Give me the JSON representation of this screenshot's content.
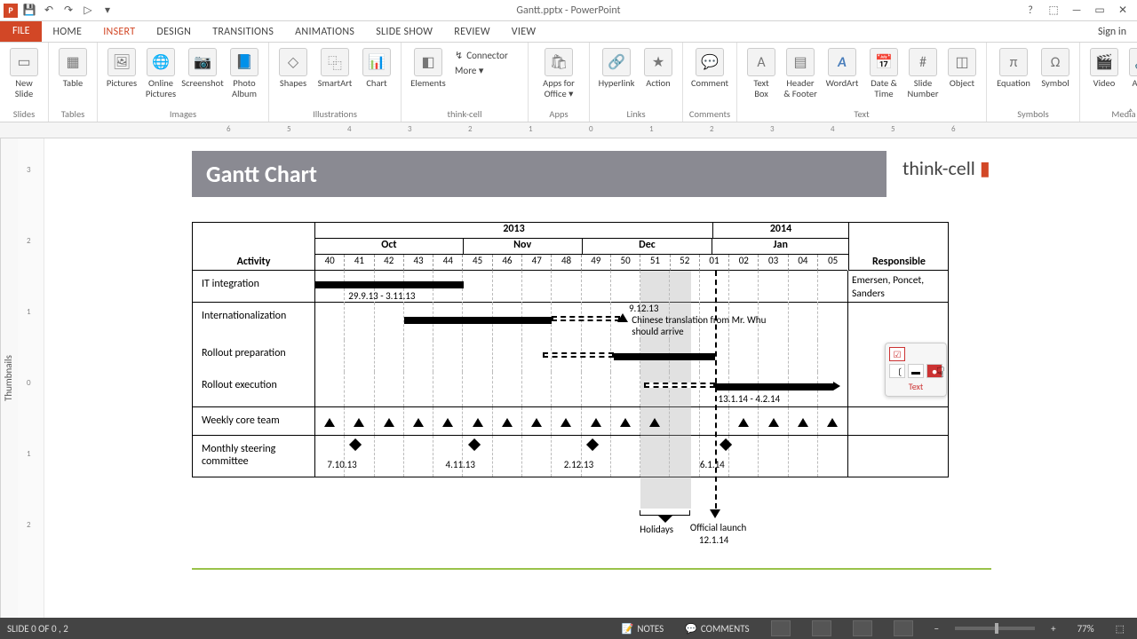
{
  "app": {
    "title": "Gantt.pptx - PowerPoint"
  },
  "qat": {
    "save": "💾",
    "undo": "↶",
    "redo": "↷",
    "start": "▷"
  },
  "win": {
    "help": "?",
    "ribopts": "⬚",
    "min": "—",
    "restore": "▭",
    "close": "✕"
  },
  "tabs": {
    "file": "FILE",
    "home": "HOME",
    "insert": "INSERT",
    "design": "DESIGN",
    "transitions": "TRANSITIONS",
    "animations": "ANIMATIONS",
    "slideshow": "SLIDE SHOW",
    "review": "REVIEW",
    "view": "VIEW",
    "signin": "Sign in"
  },
  "ribbon": {
    "newslide": "New\nSlide",
    "slides": "Slides",
    "table": "Table",
    "tables": "Tables",
    "pictures": "Pictures",
    "online_pictures": "Online\nPictures",
    "screenshot": "Screenshot",
    "photo_album": "Photo\nAlbum",
    "images": "Images",
    "shapes": "Shapes",
    "smartart": "SmartArt",
    "chart": "Chart",
    "elements": "Elements",
    "connector": "Connector",
    "more": "More ▾",
    "illustrations": "Illustrations",
    "thinkcell": "think-cell",
    "apps_office": "Apps for\nOffice ▾",
    "apps": "Apps",
    "hyperlink": "Hyperlink",
    "action": "Action",
    "links": "Links",
    "comment": "Comment",
    "comments_g": "Comments",
    "textbox": "Text\nBox",
    "headerfooter": "Header\n& Footer",
    "wordart": "WordArt",
    "datetime": "Date &\nTime",
    "slidenum": "Slide\nNumber",
    "object": "Object",
    "text_g": "Text",
    "equation": "Equation",
    "symbol": "Symbol",
    "symbols_g": "Symbols",
    "video": "Video",
    "audio": "Audio",
    "media_g": "Media"
  },
  "ruler_h": [
    "6",
    "5",
    "4",
    "3",
    "2",
    "1",
    "0",
    "1",
    "2",
    "3",
    "4",
    "5",
    "6"
  ],
  "ruler_v": [
    "3",
    "2",
    "1",
    "0",
    "1",
    "2"
  ],
  "thumbnails_label": "Thumbnails",
  "slide": {
    "title": "Gantt Chart",
    "logo_a": "think-cell",
    "logo_b": "▮"
  },
  "chart_data": {
    "type": "gantt",
    "columns": {
      "activity": "Activity",
      "responsible": "Responsible"
    },
    "years": [
      "2013",
      "2014"
    ],
    "months": [
      "Oct",
      "Nov",
      "Dec",
      "Jan"
    ],
    "weeks": [
      "40",
      "41",
      "42",
      "43",
      "44",
      "45",
      "46",
      "47",
      "48",
      "49",
      "50",
      "51",
      "52",
      "01",
      "02",
      "03",
      "04",
      "05"
    ],
    "rows": [
      {
        "activity": "IT integration",
        "responsible": "Emersen, Poncet, Sanders",
        "bar_label": "29.9.13 - 3.11.13"
      },
      {
        "activity": "Internationalization",
        "responsible": "",
        "milestone_date": "9.12.13",
        "milestone_text": "Chinese translation from Mr. Whu should arrive"
      },
      {
        "activity": "Rollout preparation",
        "responsible": ""
      },
      {
        "activity": "Rollout execution",
        "responsible": "",
        "bar_label": "13.1.14 - 4.2.14"
      },
      {
        "activity": "Weekly core team",
        "responsible": ""
      },
      {
        "activity": "Monthly steering committee",
        "responsible": "",
        "dates": [
          "7.10.13",
          "4.11.13",
          "2.12.13",
          "6.1.14"
        ]
      }
    ],
    "footer": {
      "holidays": "Holidays",
      "launch": "Official launch",
      "launch_date": "12.1.14"
    }
  },
  "float": {
    "text": "Text"
  },
  "status": {
    "slide": "SLIDE 0 OF 0 , 2",
    "notes": "NOTES",
    "comments": "COMMENTS",
    "zoom": "77%",
    "fit": "⬚"
  }
}
